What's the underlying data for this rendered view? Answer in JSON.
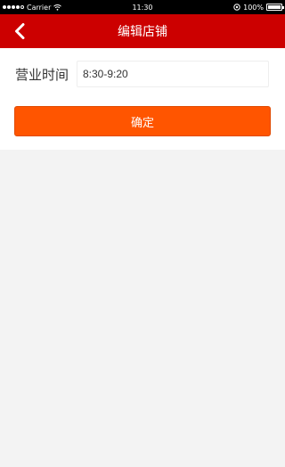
{
  "status_bar": {
    "carrier": "Carrier",
    "time": "11:30",
    "battery_percent": "100%",
    "battery_level": 1.0
  },
  "nav": {
    "title": "编辑店铺",
    "back_icon": "chevron-left-icon"
  },
  "form": {
    "business_hours_label": "营业时间",
    "business_hours_value": "8:30-9:20"
  },
  "actions": {
    "confirm_label": "确定"
  },
  "colors": {
    "nav_background": "#cc0000",
    "button_background": "#ff5500",
    "page_background": "#f3f3f3"
  }
}
